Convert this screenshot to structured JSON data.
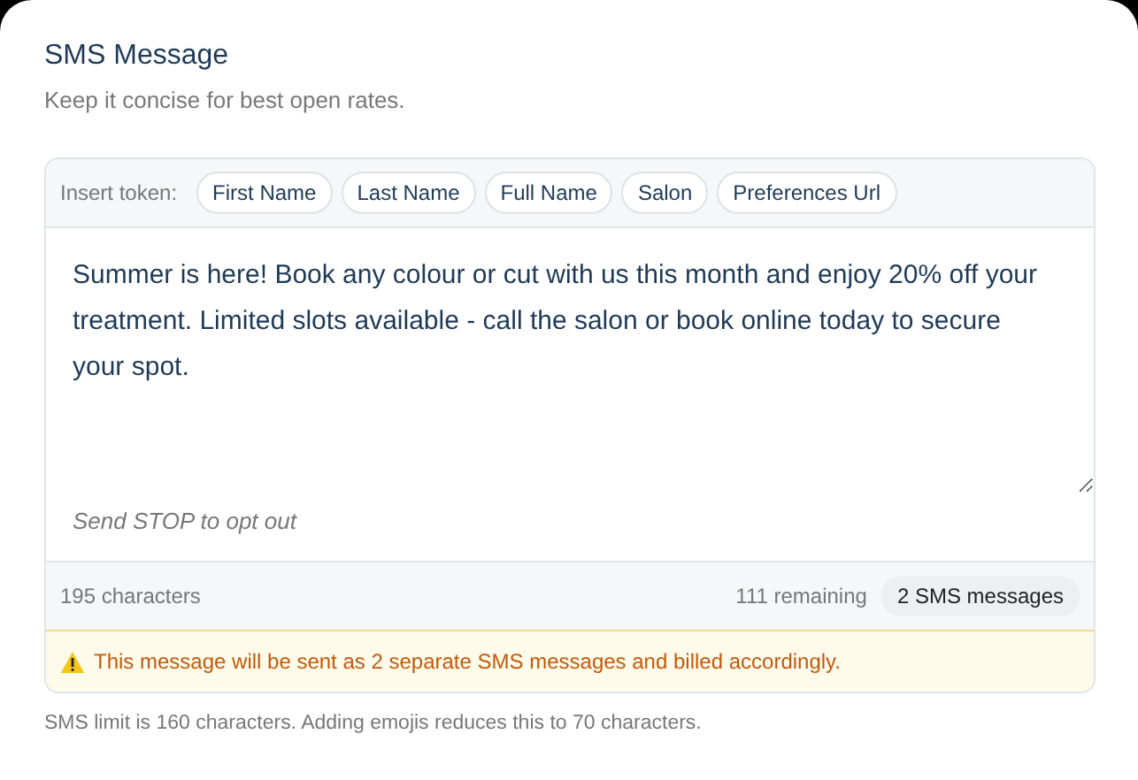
{
  "title": "SMS Message",
  "subtitle": "Keep it concise for best open rates.",
  "token_bar": {
    "label": "Insert token:",
    "tokens": [
      "First Name",
      "Last Name",
      "Full Name",
      "Salon",
      "Preferences Url"
    ]
  },
  "message": {
    "value": "Summer is here! Book any colour or cut with us this month and enjoy 20% off your treatment. Limited slots available - call the salon or book online today to secure your spot."
  },
  "opt_out": "Send STOP to opt out",
  "footer": {
    "characters": "195 characters",
    "remaining": "111 remaining",
    "segments": "2 SMS messages"
  },
  "warning": "This message will be sent as 2 separate SMS messages and billed accordingly.",
  "help_text": "SMS limit is 160 characters. Adding emojis reduces this to 70 characters."
}
